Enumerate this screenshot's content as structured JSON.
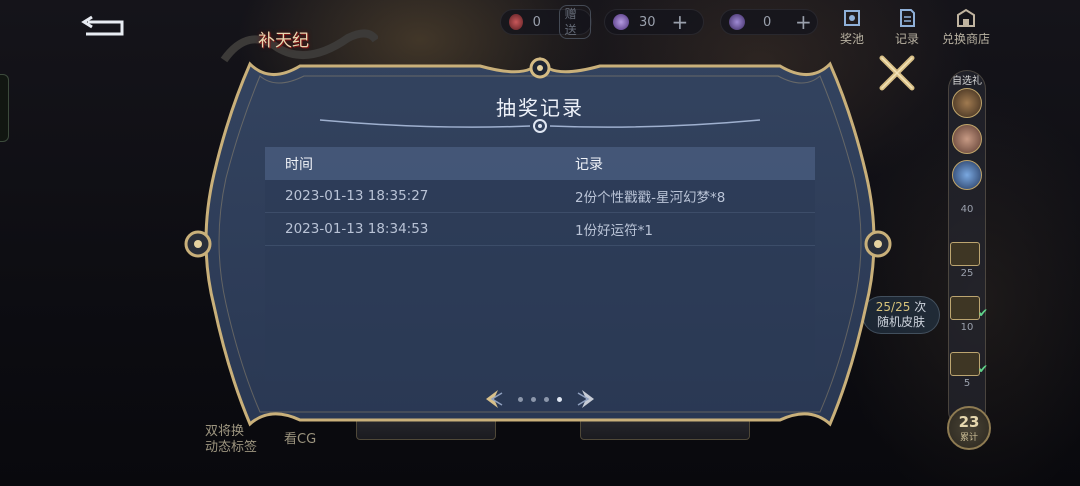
{
  "background": {
    "logo_text": "补天纪",
    "currencies": [
      {
        "icon": "crystal-icon",
        "value": "0",
        "gift_label": "赠送"
      },
      {
        "icon": "diamond-icon",
        "value": "30"
      },
      {
        "icon": "gem-icon",
        "value": "0"
      }
    ],
    "top_links": [
      {
        "icon": "prize-pool-icon",
        "label": "奖池"
      },
      {
        "icon": "record-icon",
        "label": "记录"
      },
      {
        "icon": "shop-icon",
        "label": "兑换商店"
      }
    ],
    "rail": {
      "header": "自选礼",
      "milestones": [
        "40",
        "25",
        "10",
        "5"
      ],
      "total_count": "23",
      "total_label": "累计"
    },
    "progress_pill": {
      "count": "25/25",
      "suffix": "次",
      "label": "随机皮肤"
    },
    "bottom_labels": [
      "双将换",
      "动态标签",
      "看CG"
    ]
  },
  "modal": {
    "title": "抽奖记录",
    "columns": [
      "时间",
      "记录"
    ],
    "rows": [
      {
        "time": "2023-01-13 18:35:27",
        "record": "2份个性戳戳-星河幻梦*8"
      },
      {
        "time": "2023-01-13 18:34:53",
        "record": "1份好运符*1"
      }
    ],
    "pager": {
      "total_pages": 4,
      "current_page": 4
    }
  },
  "colors": {
    "panel": "#2c3b58",
    "frame_gold": "#c9b07a",
    "header_row": "#485b7c"
  }
}
